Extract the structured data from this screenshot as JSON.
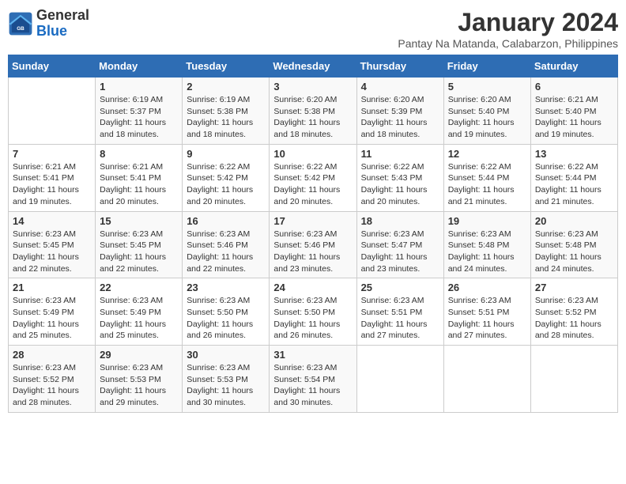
{
  "logo": {
    "text_general": "General",
    "text_blue": "Blue"
  },
  "title": "January 2024",
  "subtitle": "Pantay Na Matanda, Calabarzon, Philippines",
  "days_header": [
    "Sunday",
    "Monday",
    "Tuesday",
    "Wednesday",
    "Thursday",
    "Friday",
    "Saturday"
  ],
  "weeks": [
    [
      {
        "day": "",
        "info": ""
      },
      {
        "day": "1",
        "info": "Sunrise: 6:19 AM\nSunset: 5:37 PM\nDaylight: 11 hours\nand 18 minutes."
      },
      {
        "day": "2",
        "info": "Sunrise: 6:19 AM\nSunset: 5:38 PM\nDaylight: 11 hours\nand 18 minutes."
      },
      {
        "day": "3",
        "info": "Sunrise: 6:20 AM\nSunset: 5:38 PM\nDaylight: 11 hours\nand 18 minutes."
      },
      {
        "day": "4",
        "info": "Sunrise: 6:20 AM\nSunset: 5:39 PM\nDaylight: 11 hours\nand 18 minutes."
      },
      {
        "day": "5",
        "info": "Sunrise: 6:20 AM\nSunset: 5:40 PM\nDaylight: 11 hours\nand 19 minutes."
      },
      {
        "day": "6",
        "info": "Sunrise: 6:21 AM\nSunset: 5:40 PM\nDaylight: 11 hours\nand 19 minutes."
      }
    ],
    [
      {
        "day": "7",
        "info": "Sunrise: 6:21 AM\nSunset: 5:41 PM\nDaylight: 11 hours\nand 19 minutes."
      },
      {
        "day": "8",
        "info": "Sunrise: 6:21 AM\nSunset: 5:41 PM\nDaylight: 11 hours\nand 20 minutes."
      },
      {
        "day": "9",
        "info": "Sunrise: 6:22 AM\nSunset: 5:42 PM\nDaylight: 11 hours\nand 20 minutes."
      },
      {
        "day": "10",
        "info": "Sunrise: 6:22 AM\nSunset: 5:42 PM\nDaylight: 11 hours\nand 20 minutes."
      },
      {
        "day": "11",
        "info": "Sunrise: 6:22 AM\nSunset: 5:43 PM\nDaylight: 11 hours\nand 20 minutes."
      },
      {
        "day": "12",
        "info": "Sunrise: 6:22 AM\nSunset: 5:44 PM\nDaylight: 11 hours\nand 21 minutes."
      },
      {
        "day": "13",
        "info": "Sunrise: 6:22 AM\nSunset: 5:44 PM\nDaylight: 11 hours\nand 21 minutes."
      }
    ],
    [
      {
        "day": "14",
        "info": "Sunrise: 6:23 AM\nSunset: 5:45 PM\nDaylight: 11 hours\nand 22 minutes."
      },
      {
        "day": "15",
        "info": "Sunrise: 6:23 AM\nSunset: 5:45 PM\nDaylight: 11 hours\nand 22 minutes."
      },
      {
        "day": "16",
        "info": "Sunrise: 6:23 AM\nSunset: 5:46 PM\nDaylight: 11 hours\nand 22 minutes."
      },
      {
        "day": "17",
        "info": "Sunrise: 6:23 AM\nSunset: 5:46 PM\nDaylight: 11 hours\nand 23 minutes."
      },
      {
        "day": "18",
        "info": "Sunrise: 6:23 AM\nSunset: 5:47 PM\nDaylight: 11 hours\nand 23 minutes."
      },
      {
        "day": "19",
        "info": "Sunrise: 6:23 AM\nSunset: 5:48 PM\nDaylight: 11 hours\nand 24 minutes."
      },
      {
        "day": "20",
        "info": "Sunrise: 6:23 AM\nSunset: 5:48 PM\nDaylight: 11 hours\nand 24 minutes."
      }
    ],
    [
      {
        "day": "21",
        "info": "Sunrise: 6:23 AM\nSunset: 5:49 PM\nDaylight: 11 hours\nand 25 minutes."
      },
      {
        "day": "22",
        "info": "Sunrise: 6:23 AM\nSunset: 5:49 PM\nDaylight: 11 hours\nand 25 minutes."
      },
      {
        "day": "23",
        "info": "Sunrise: 6:23 AM\nSunset: 5:50 PM\nDaylight: 11 hours\nand 26 minutes."
      },
      {
        "day": "24",
        "info": "Sunrise: 6:23 AM\nSunset: 5:50 PM\nDaylight: 11 hours\nand 26 minutes."
      },
      {
        "day": "25",
        "info": "Sunrise: 6:23 AM\nSunset: 5:51 PM\nDaylight: 11 hours\nand 27 minutes."
      },
      {
        "day": "26",
        "info": "Sunrise: 6:23 AM\nSunset: 5:51 PM\nDaylight: 11 hours\nand 27 minutes."
      },
      {
        "day": "27",
        "info": "Sunrise: 6:23 AM\nSunset: 5:52 PM\nDaylight: 11 hours\nand 28 minutes."
      }
    ],
    [
      {
        "day": "28",
        "info": "Sunrise: 6:23 AM\nSunset: 5:52 PM\nDaylight: 11 hours\nand 28 minutes."
      },
      {
        "day": "29",
        "info": "Sunrise: 6:23 AM\nSunset: 5:53 PM\nDaylight: 11 hours\nand 29 minutes."
      },
      {
        "day": "30",
        "info": "Sunrise: 6:23 AM\nSunset: 5:53 PM\nDaylight: 11 hours\nand 30 minutes."
      },
      {
        "day": "31",
        "info": "Sunrise: 6:23 AM\nSunset: 5:54 PM\nDaylight: 11 hours\nand 30 minutes."
      },
      {
        "day": "",
        "info": ""
      },
      {
        "day": "",
        "info": ""
      },
      {
        "day": "",
        "info": ""
      }
    ]
  ]
}
